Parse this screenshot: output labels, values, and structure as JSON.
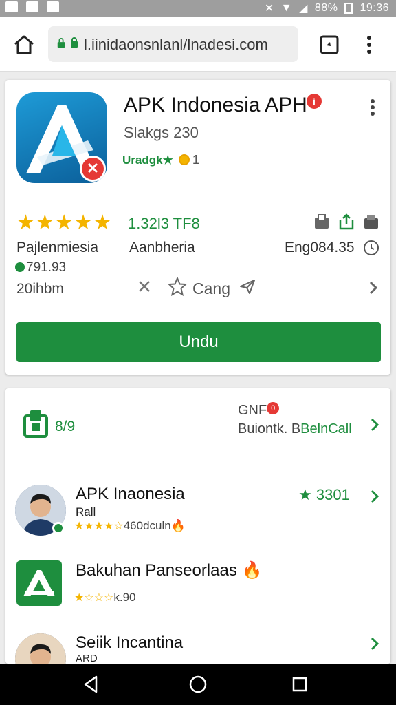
{
  "status_bar": {
    "battery": "88%",
    "time": "19:36"
  },
  "browser": {
    "url": "l.iinidaonsnlanl/lnadesi.com"
  },
  "app": {
    "title": "APK Indonesia APH",
    "title_badge": "i",
    "subtitle": "Slakgs 230",
    "developer": "Uradgk",
    "developer_count": "1",
    "rating_stars": "★★★★★",
    "size": "1.32l3 TF8",
    "category": "Pajlenmiesia",
    "publisher": "Aanbheria",
    "version": "Eng084.35",
    "downloads": "791.93",
    "age": "20ihbm",
    "collection_label": "Cang",
    "download_button": "Undu"
  },
  "section": {
    "count": "8/9",
    "line1": "GNF",
    "line1_badge": "0",
    "line2_prefix": "Buiontk. B",
    "line2_link": "BelnCall"
  },
  "list": [
    {
      "title": "APK Inaonesia",
      "subtitle": "Rall",
      "stars": "★★★★☆",
      "meta": "460dculn",
      "rating": "3301",
      "icon": "person-avatar"
    },
    {
      "title": "Bakuhan Panseorlaas",
      "stars": "★☆☆☆",
      "meta": "k.90",
      "icon": "apk-app-icon"
    },
    {
      "title": "Seiik Incantina",
      "subtitle": "ARD",
      "icon": "person-avatar"
    }
  ],
  "colors": {
    "accent_green": "#1e8e3e",
    "star_yellow": "#f4b400",
    "badge_red": "#e53935"
  }
}
